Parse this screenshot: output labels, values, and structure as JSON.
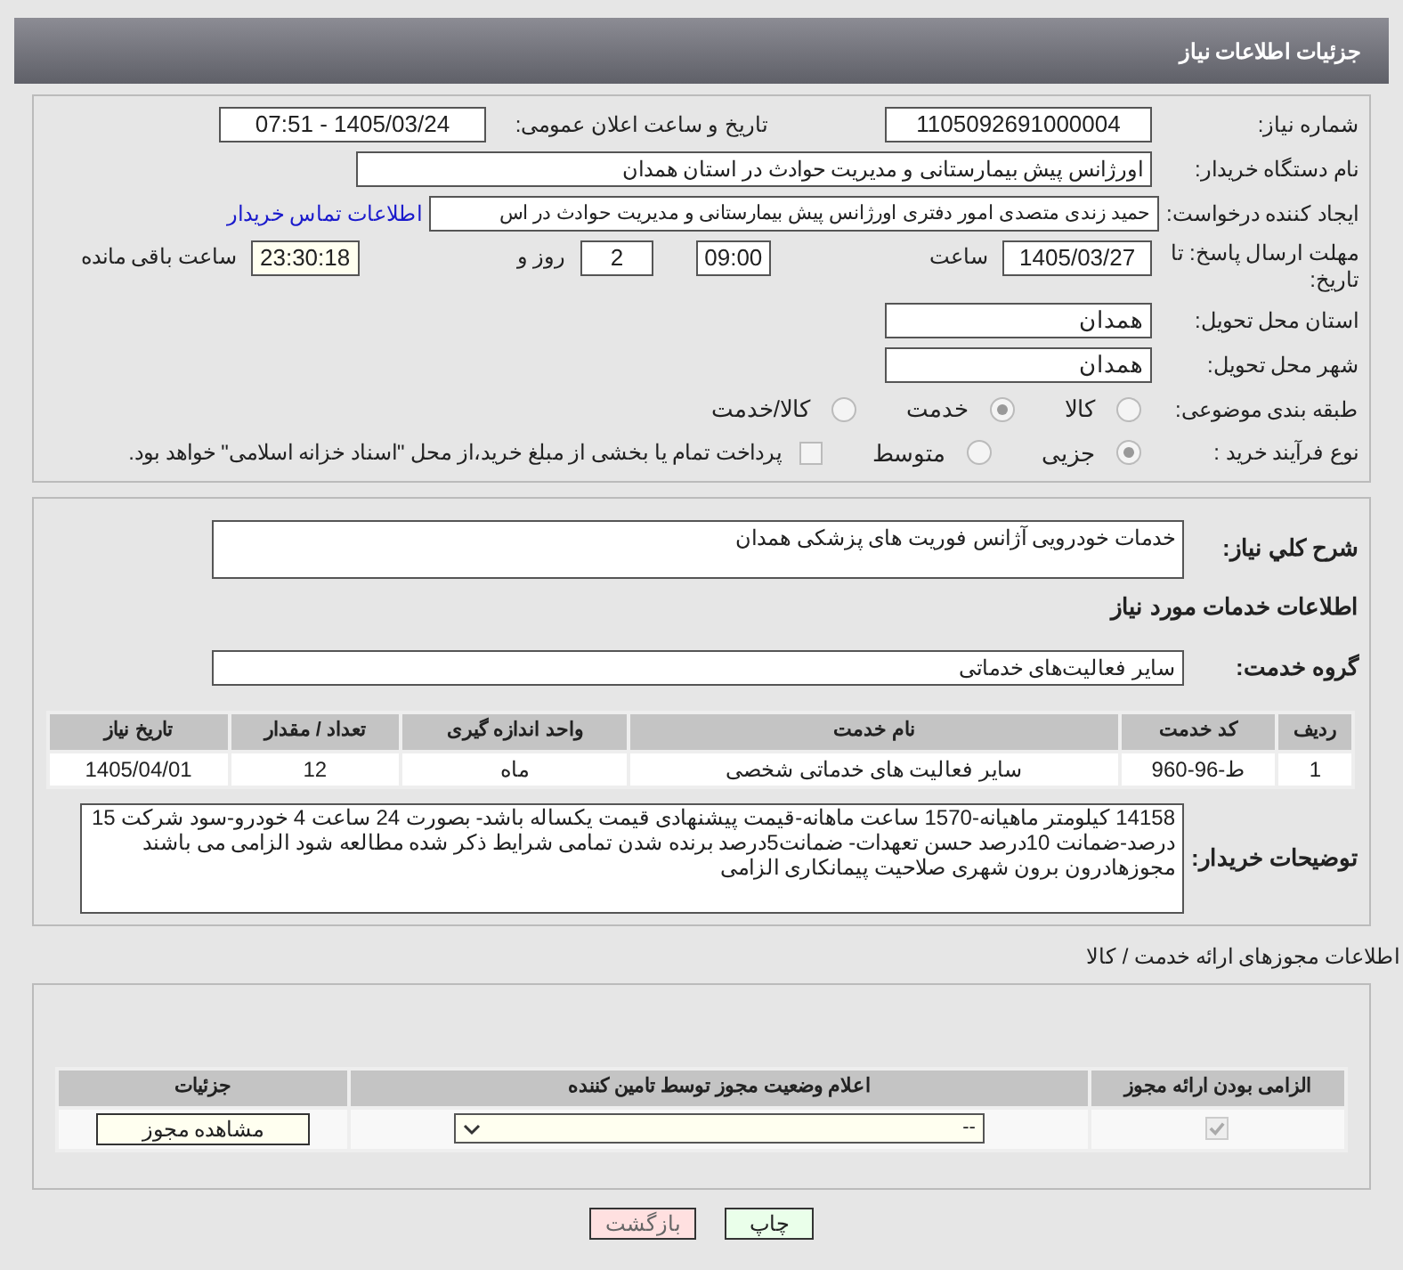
{
  "header": {
    "title": "جزئیات اطلاعات نیاز"
  },
  "need_number": {
    "label": "شماره نیاز:",
    "value": "1105092691000004"
  },
  "announce": {
    "label": "تاریخ و ساعت اعلان عمومی:",
    "value": "1405/03/24 - 07:51"
  },
  "buyer": {
    "label": "نام دستگاه خریدار:",
    "value": "اورژانس پیش بیمارستانی و مدیریت حوادث در استان  همدان"
  },
  "requester": {
    "label": "ایجاد کننده درخواست:",
    "value": "حمید زندی متصدی امور دفتری اورژانس پیش بیمارستانی و مدیریت حوادث در اس",
    "link": "اطلاعات تماس خریدار"
  },
  "deadline": {
    "label": "مهلت ارسال پاسخ: تا تاریخ:",
    "date": "1405/03/27",
    "time_label": "ساعت",
    "time": "09:00",
    "days": "2",
    "days_label": "روز و",
    "remaining": "23:30:18",
    "remaining_label": "ساعت باقی مانده"
  },
  "province": {
    "label": "استان محل تحویل:",
    "value": "همدان"
  },
  "city": {
    "label": "شهر محل تحویل:",
    "value": "همدان"
  },
  "category": {
    "label": "طبقه بندی موضوعی:",
    "options": [
      {
        "label": "کالا",
        "selected": false
      },
      {
        "label": "خدمت",
        "selected": true
      },
      {
        "label": "کالا/خدمت",
        "selected": false
      }
    ]
  },
  "process": {
    "label": "نوع فرآیند خرید :",
    "options": [
      {
        "label": "جزیی",
        "selected": true
      },
      {
        "label": "متوسط",
        "selected": false
      }
    ],
    "treasury": {
      "checked": false,
      "label": "پرداخت تمام یا بخشی از مبلغ خرید،از محل \"اسناد خزانه اسلامی\" خواهد بود."
    }
  },
  "summary": {
    "label": "شرح كلي نياز:",
    "value": "خدمات خودرویی آژانس فوریت های پزشکی همدان"
  },
  "services_title": "اطلاعات خدمات مورد نیاز",
  "service_group": {
    "label": "گروه خدمت:",
    "value": "سایر فعالیت‌های خدماتی"
  },
  "services_table": {
    "columns": [
      "ردیف",
      "کد خدمت",
      "نام خدمت",
      "واحد اندازه گیری",
      "تعداد / مقدار",
      "تاریخ نیاز"
    ],
    "rows": [
      [
        "1",
        "ط-96-960",
        "سایر فعالیت های خدماتی شخصی",
        "ماه",
        "12",
        "1405/04/01"
      ]
    ]
  },
  "buyer_notes": {
    "label": "توضیحات خریدار:",
    "value": "14158 کیلومتر ماهیانه-1570 ساعت ماهانه-قیمت پیشنهادی قیمت یکساله باشد- بصورت 24 ساعت 4 خودرو-سود شرکت 15 درصد-ضمانت 10درصد حسن تعهدات- ضمانت5درصد برنده شدن تمامی شرایط ذکر شده مطالعه شود الزامی می باشند مجوزهادرون برون شهری صلاحیت پیمانکاری الزامی"
  },
  "permits_title": "اطلاعات مجوزهای ارائه خدمت / کالا",
  "permits_table": {
    "columns": [
      "الزامی بودن ارائه مجوز",
      "اعلام وضعیت مجوز توسط تامین کننده",
      "جزئیات"
    ],
    "rows": [
      {
        "required": true,
        "status": "--",
        "button": "مشاهده مجوز"
      }
    ]
  },
  "buttons": [
    {
      "label": "چاپ",
      "kind": "print"
    },
    {
      "label": "بازگشت",
      "kind": "back"
    }
  ]
}
